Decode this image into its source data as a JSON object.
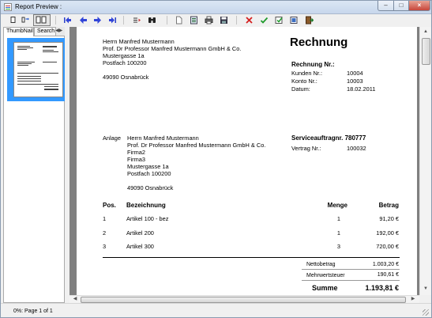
{
  "window": {
    "title": "Report Preview :"
  },
  "left_panel": {
    "tabs": [
      {
        "label": "ThumbNails"
      },
      {
        "label": "Search I"
      }
    ]
  },
  "status": {
    "text": "0%: Page 1 of 1"
  },
  "icons": [
    "single-page-icon",
    "two-pages-icon",
    "page-width-icon",
    "first-page-icon",
    "prev-page-icon",
    "next-page-icon",
    "last-page-icon",
    "text-mode-icon",
    "find-icon",
    "new-page-icon",
    "print-setup-icon",
    "print-icon",
    "save-icon",
    "close-icon",
    "confirm-icon",
    "check-icon",
    "export-icon",
    "exit-icon"
  ],
  "report": {
    "sender": {
      "name": "Herrn Manfred Mustermann",
      "company": "Prof. Dr Professor Manfred Mustermann GmbH & Co.",
      "street": "Mustergasse 1a",
      "pobox": "Postfach 100200",
      "city": "49090 Osnabrück"
    },
    "heading": "Rechnung",
    "invoice_block": {
      "title": "Rechnung Nr.:",
      "fields": [
        {
          "label": "Kunden Nr.:",
          "value": "10004"
        },
        {
          "label": "Konto Nr.:",
          "value": "10003"
        },
        {
          "label": "Datum:",
          "value": "18.02.2011"
        }
      ]
    },
    "attachment": {
      "label": "Anlage",
      "lines": [
        "Herrn Manfred Mustermann",
        "Prof. Dr Professor Manfred Mustermann GmbH & Co.",
        "Firma2",
        "Firma3",
        "Mustergasse 1a",
        "Postfach 100200",
        "",
        "49090 Osnabrück"
      ]
    },
    "service": {
      "title": "Serviceauftragnr. 780777",
      "contract_label": "Vertrag Nr.:",
      "contract_value": "100032"
    },
    "table": {
      "headers": {
        "pos": "Pos.",
        "desc": "Bezeichnung",
        "qty": "Menge",
        "amount": "Betrag"
      },
      "rows": [
        {
          "pos": "1",
          "desc": "Artikel 100 - bez",
          "qty": "1",
          "amount": "91,20 €"
        },
        {
          "pos": "2",
          "desc": "Artikel 200",
          "qty": "1",
          "amount": "192,00 €"
        },
        {
          "pos": "3",
          "desc": "Artikel 300",
          "qty": "3",
          "amount": "720,00 €"
        }
      ]
    },
    "totals": {
      "net_label": "Nettobetrag",
      "net_value": "1.003,20 €",
      "vat_label": "Mehrwertsteuer",
      "vat_value": "190,61 €",
      "sum_label": "Summe",
      "sum_value": "1.193,81 €"
    }
  }
}
